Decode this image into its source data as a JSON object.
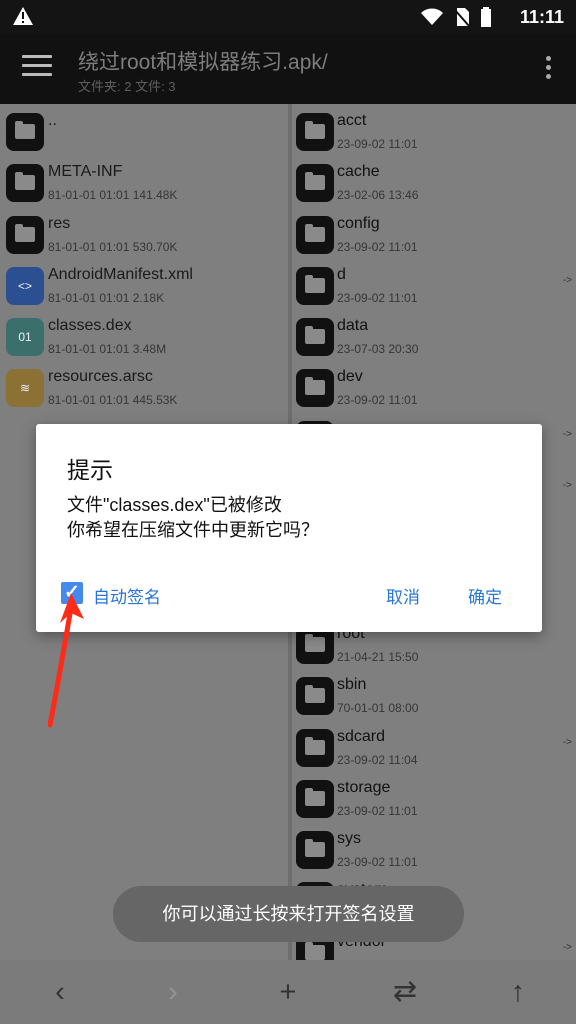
{
  "status": {
    "time": "11:11",
    "icons": [
      "warning-icon",
      "wifi-icon",
      "no-sim-icon",
      "battery-icon"
    ]
  },
  "toolbar": {
    "title": "绕过root和模拟器练习.apk/",
    "subtitle": "文件夹: 2 文件: 3",
    "menu_icon": "menu-icon",
    "more_icon": "more-vertical-icon"
  },
  "left_items": [
    {
      "name": "..",
      "meta": "",
      "icon": "folder-icon"
    },
    {
      "name": "META-INF",
      "meta": "81-01-01 01:01  141.48K",
      "icon": "folder-icon"
    },
    {
      "name": "res",
      "meta": "81-01-01 01:01  530.70K",
      "icon": "folder-icon"
    },
    {
      "name": "AndroidManifest.xml",
      "meta": "81-01-01 01:01  2.18K",
      "icon": "xml-file-icon"
    },
    {
      "name": "classes.dex",
      "meta": "81-01-01 01:01  3.48M",
      "icon": "dex-file-icon"
    },
    {
      "name": "resources.arsc",
      "meta": "81-01-01 01:01  445.53K",
      "icon": "arsc-file-icon"
    }
  ],
  "right_items": [
    {
      "name": "acct",
      "meta": "23-09-02 11:01",
      "arrow": ""
    },
    {
      "name": "cache",
      "meta": "23-02-06 13:46",
      "arrow": ""
    },
    {
      "name": "config",
      "meta": "23-09-02 11:01",
      "arrow": ""
    },
    {
      "name": "d",
      "meta": "23-09-02 11:01",
      "arrow": "->"
    },
    {
      "name": "data",
      "meta": "23-07-03 20:30",
      "arrow": ""
    },
    {
      "name": "dev",
      "meta": "23-09-02 11:01",
      "arrow": ""
    },
    {
      "name": "",
      "meta": "",
      "arrow": "->"
    },
    {
      "name": "",
      "meta": "",
      "arrow": "->"
    },
    {
      "name": "",
      "meta": "",
      "arrow": ""
    },
    {
      "name": "",
      "meta": "",
      "arrow": ""
    },
    {
      "name": "root",
      "meta": "21-04-21 15:50",
      "arrow": ""
    },
    {
      "name": "sbin",
      "meta": "70-01-01 08:00",
      "arrow": ""
    },
    {
      "name": "sdcard",
      "meta": "23-09-02 11:04",
      "arrow": "->"
    },
    {
      "name": "storage",
      "meta": "23-09-02 11:01",
      "arrow": ""
    },
    {
      "name": "sys",
      "meta": "23-09-02 11:01",
      "arrow": ""
    },
    {
      "name": "system",
      "meta": "",
      "arrow": ""
    },
    {
      "name": "vendor",
      "meta": "",
      "arrow": "->"
    }
  ],
  "dialog": {
    "title": "提示",
    "message": "文件\"classes.dex\"已被修改\n你希望在压缩文件中更新它吗？",
    "checkbox_label": "自动签名",
    "checkbox_checked": true,
    "cancel": "取消",
    "ok": "确定"
  },
  "toast": "你可以通过长按来打开签名设置",
  "bottom_nav": [
    "back-icon",
    "forward-icon",
    "add-icon",
    "swap-icon",
    "up-icon"
  ],
  "colors": {
    "accent": "#2775d5",
    "checkbox": "#4689ec",
    "dimmed_background": "#7f7f7f"
  }
}
